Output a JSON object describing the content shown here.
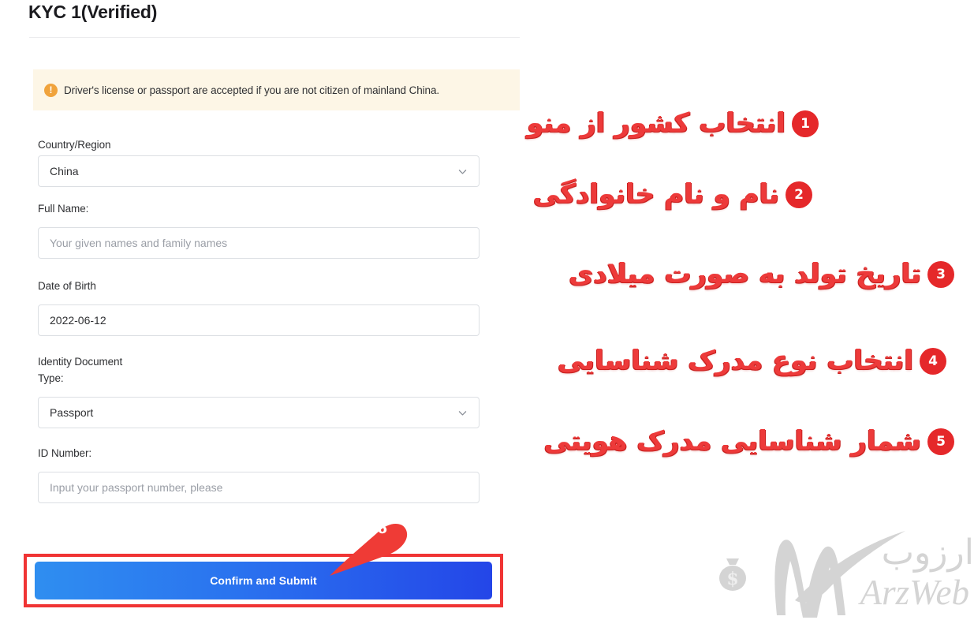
{
  "page": {
    "title": "KYC 1(Verified)"
  },
  "alert": {
    "icon": "exclamation-circle-icon",
    "icon_glyph": "!",
    "text": "Driver's license or passport are accepted if you are not citizen of mainland China.",
    "background_color": "#fdf6e6",
    "icon_color": "#f0a33c"
  },
  "form": {
    "country": {
      "label": "Country/Region",
      "value": "China",
      "chevron": "chevron-down-icon"
    },
    "full_name": {
      "label": "Full Name:",
      "value": "",
      "placeholder": "Your given names and family names"
    },
    "date_of_birth": {
      "label": "Date of Birth",
      "value": "2022-06-12"
    },
    "id_type": {
      "label": "Identity Document\nType:",
      "value": "Passport",
      "chevron": "chevron-down-icon"
    },
    "id_number": {
      "label": "ID Number:",
      "value": "",
      "placeholder": "Input your passport number, please"
    },
    "submit": {
      "label": "Confirm and Submit",
      "gradient_from": "#2f8ef0",
      "gradient_to": "#2446e8",
      "highlight_color": "#f03434"
    }
  },
  "annotations": {
    "badge_color": "#e5282a",
    "text_color": "#ed3a3a",
    "items": [
      {
        "number": "1",
        "text": "انتخاب کشور از منو"
      },
      {
        "number": "2",
        "text": "نام و نام خانوادگی"
      },
      {
        "number": "3",
        "text": "تاریخ تولد به صورت میلادی"
      },
      {
        "number": "4",
        "text": "انتخاب نوع مدرک شناسایی"
      },
      {
        "number": "5",
        "text": "شمار شناسایی مدرک هویتی"
      },
      {
        "number": "6",
        "text": ""
      }
    ]
  },
  "watermark": {
    "persian": "ارزوب",
    "latin": "ArzWeb",
    "icons": [
      "money-bag-icon",
      "w-swoosh-logo-icon"
    ],
    "color": "#d4d4d4"
  }
}
